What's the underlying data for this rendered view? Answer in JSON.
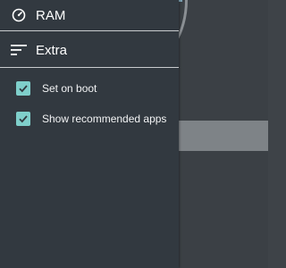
{
  "drawer": {
    "items": [
      {
        "label": "RAM",
        "icon": "speedometer-icon"
      },
      {
        "label": "Extra",
        "icon": "sort-lines-icon"
      }
    ],
    "settings": [
      {
        "label": "Set on boot",
        "checked": true
      },
      {
        "label": "Show recommended apps",
        "checked": true
      }
    ]
  },
  "colors": {
    "drawer_background": "#323940",
    "checkbox_accent": "#7fcfcb",
    "app_background": "#3b4045"
  }
}
